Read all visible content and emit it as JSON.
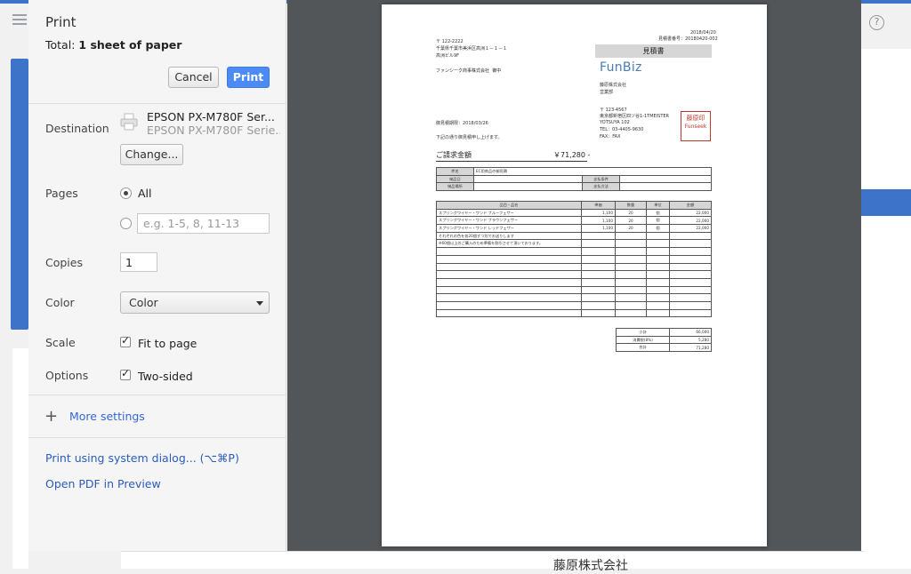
{
  "dialog": {
    "title": "Print",
    "total_prefix": "Total: ",
    "total_value": "1 sheet of paper",
    "cancel_label": "Cancel",
    "print_label": "Print",
    "destination_label": "Destination",
    "printer_name": "EPSON PX-M780F Ser...",
    "printer_sub": "EPSON PX-M780F Serie...",
    "change_label": "Change...",
    "pages_label": "Pages",
    "pages_all_label": "All",
    "pages_placeholder": "e.g. 1-5, 8, 11-13",
    "copies_label": "Copies",
    "copies_value": "1",
    "color_label": "Color",
    "color_value": "Color",
    "scale_label": "Scale",
    "fit_label": "Fit to page",
    "options_label": "Options",
    "two_sided_label": "Two-sided",
    "more_settings_label": "More settings",
    "system_dialog_label": "Print using system dialog... (⌥⌘P)",
    "open_pdf_label": "Open PDF in Preview"
  },
  "background": {
    "bottom_text": "藤原株式会社",
    "help_glyph": "?"
  },
  "colors": {
    "accent": "#3d73c8",
    "print_button": "#4c8bf5",
    "preview_bg": "#525659"
  },
  "document": {
    "date": "2018/04/20",
    "quote_number": "見積書番号：20180420-002",
    "postal": "〒 122-2222",
    "address": "千葉県千葉市美浜区高洲１－１－１",
    "building": "高洲ビル9F",
    "company": "ファンシーク商事株式会社",
    "honorific": "御中",
    "heading": "見積書",
    "logo": "FunBiz",
    "issuer_company": "藤原株式会社",
    "issuer_dept": "営業部",
    "issuer_postal": "〒 123-4567",
    "issuer_address": "東京都新宿区四ツ谷1-1TMEISTER",
    "issuer_building": "YOTSUYA 102",
    "issuer_tel": "TEL：03-4405-9630",
    "issuer_fax": "FAX：FAX",
    "valid_until": "御見積期限：2018/03/26",
    "intro": "下記の通り御見積申し上げます。",
    "amount_label": "ご請求金額",
    "amount_value": "￥71,280 -",
    "stamp_top": "藤原印",
    "stamp_bottom": "Funseek",
    "info": {
      "subject_label": "件名",
      "subject_value": "EC用商品の御見積",
      "delivery_date_label": "納品日",
      "payment_terms_label": "支払条件",
      "delivery_place_label": "納品場所",
      "payment_method_label": "支払方法"
    },
    "items_header": [
      "品目・品名",
      "単価",
      "数量",
      "単位",
      "金額"
    ],
    "items": [
      [
        "スプリングワイヤー・ワンド ブルーフェザー",
        "1,100",
        "20",
        "個",
        "22,000"
      ],
      [
        "スプリングワイヤー・ワンド ブラウンフェザー",
        "1,100",
        "20",
        "個",
        "22,000"
      ],
      [
        "スプリングワイヤー・ワンド レッドフェザー",
        "1,100",
        "20",
        "個",
        "22,000"
      ],
      [
        "それぞれの色を各20個ずつ別でお送りします",
        "",
        "",
        "",
        ""
      ],
      [
        "※60個以上のご購入のため準備を割引させて頂いております。",
        "",
        "",
        "",
        ""
      ]
    ],
    "totals": [
      [
        "小計",
        "66,000"
      ],
      [
        "消費税(8%)",
        "5,280"
      ],
      [
        "合計",
        "71,280"
      ]
    ]
  }
}
